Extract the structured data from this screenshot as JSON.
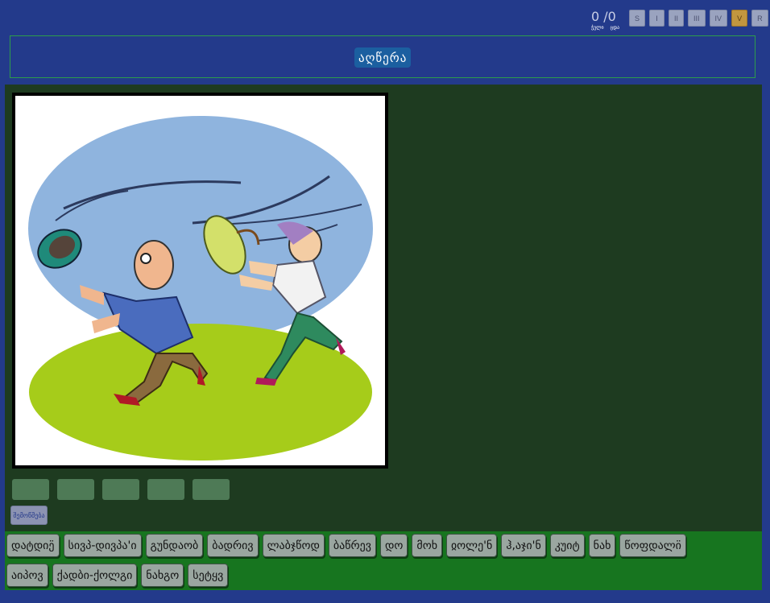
{
  "header": {
    "score": "0 /0",
    "score_labels": [
      "ჭელი",
      "ცდა"
    ],
    "levels": [
      "S",
      "I",
      "II",
      "III",
      "IV",
      "V",
      "R"
    ],
    "active_level": "V"
  },
  "title": "აღწერა",
  "picture": {
    "icons": [
      "wind-gust-illustration",
      "flying-hat-icon",
      "flying-umbrella-icon"
    ]
  },
  "answer_slots": 5,
  "check_label": "შემოწმება",
  "word_bank": {
    "row1": [
      "დატდიე̈",
      "სივპ-დივპა'ი",
      "გუნდაობ",
      "ბადრივ",
      "ლაბჯწოდ",
      "ბაწრევ",
      "დო",
      "მოხ",
      "ჲოლე'ნ",
      "ჰ,აჯი'ნ",
      "კუიტ",
      "ნახ",
      "წოფდალი̈"
    ],
    "row2": [
      "აიპოვ",
      "ქადბი-ქოლგი",
      "ნახგო",
      "სეტყვ"
    ]
  },
  "colors": {
    "page_bg": "#233a8b",
    "work_bg": "#1e3b20",
    "bank_bg": "#17751f",
    "active_level": "#c1963f"
  }
}
